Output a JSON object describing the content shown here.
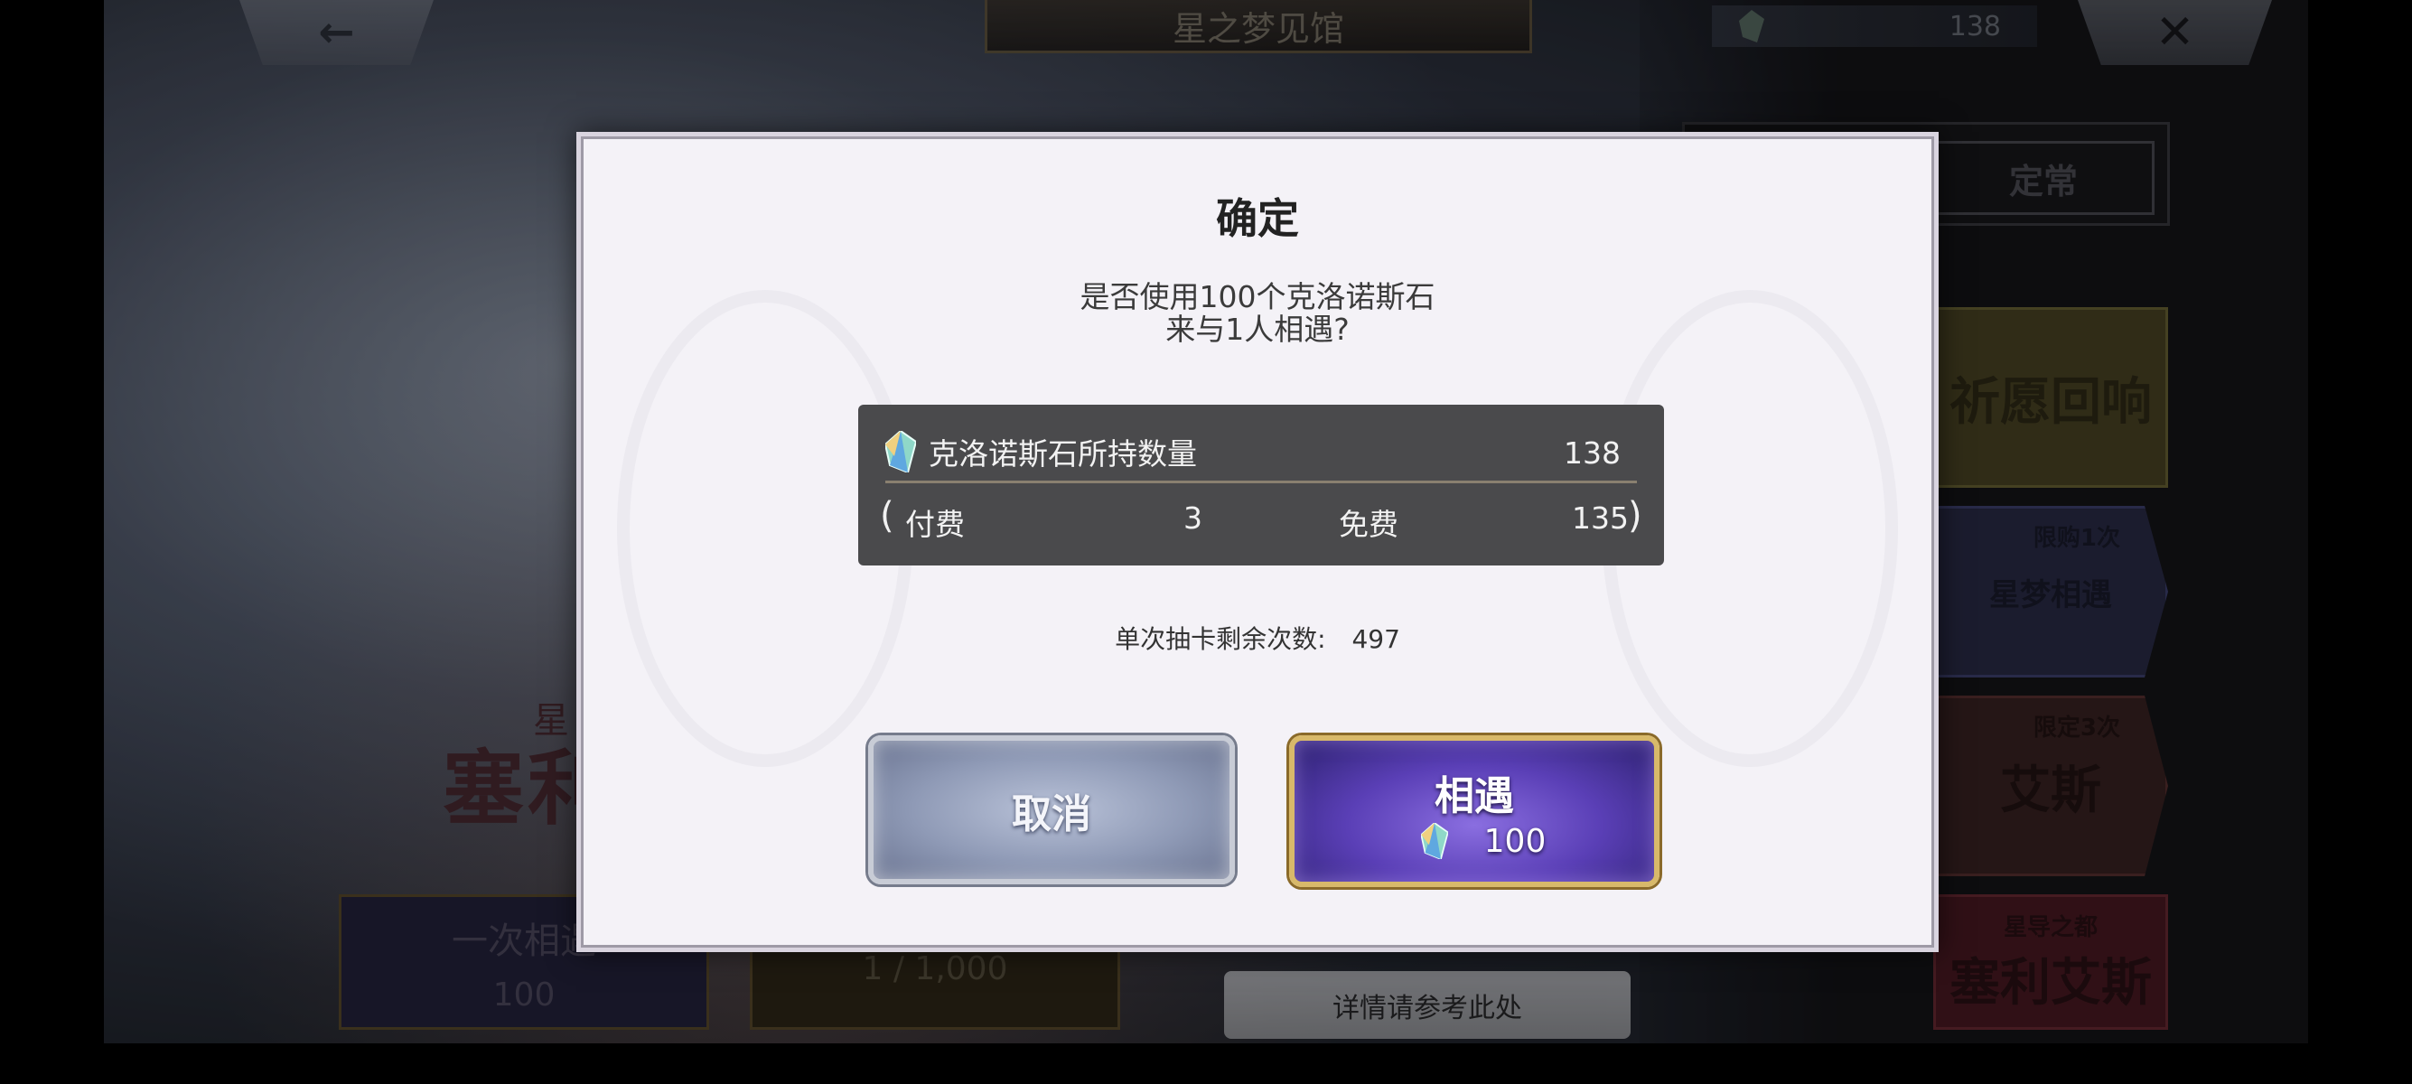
{
  "topbar": {
    "back_icon": "back-arrow-icon",
    "title": "星之梦见馆",
    "currency_icon": "chronos-stone-icon",
    "currency_value": "138",
    "close_icon": "close-icon"
  },
  "right_menu": {
    "tab_regular": "定常",
    "banner1_text": "祈愿回响",
    "banner2_tag": "限购1次",
    "banner2_text": "星梦相遇",
    "banner3_tag": "限定3次",
    "banner3_text": "艾斯",
    "banner4_sub": "星导之都",
    "banner4_text": "塞利艾斯"
  },
  "background": {
    "char_subtitle": "星",
    "char_name": "塞利",
    "single_pull_label": "一次相遇",
    "single_pull_cost": "100",
    "ten_pull_cost": "1 / 1,000",
    "details_button": "详情请参考此处"
  },
  "dialog": {
    "title": "确定",
    "message_line1": "是否使用100个克洛诺斯石",
    "message_line2": "来与1人相遇?",
    "stones_label": "克洛诺斯石所持数量",
    "stones_total": "138",
    "paren_open": "(",
    "paid_label": "付费",
    "paid_value": "3",
    "free_label": "免费",
    "free_value": "135",
    "paren_close": ")",
    "remaining_label": "单次抽卡剩余次数:",
    "remaining_value": "497",
    "cancel_button": "取消",
    "confirm_button": "相遇",
    "confirm_cost": "100"
  }
}
